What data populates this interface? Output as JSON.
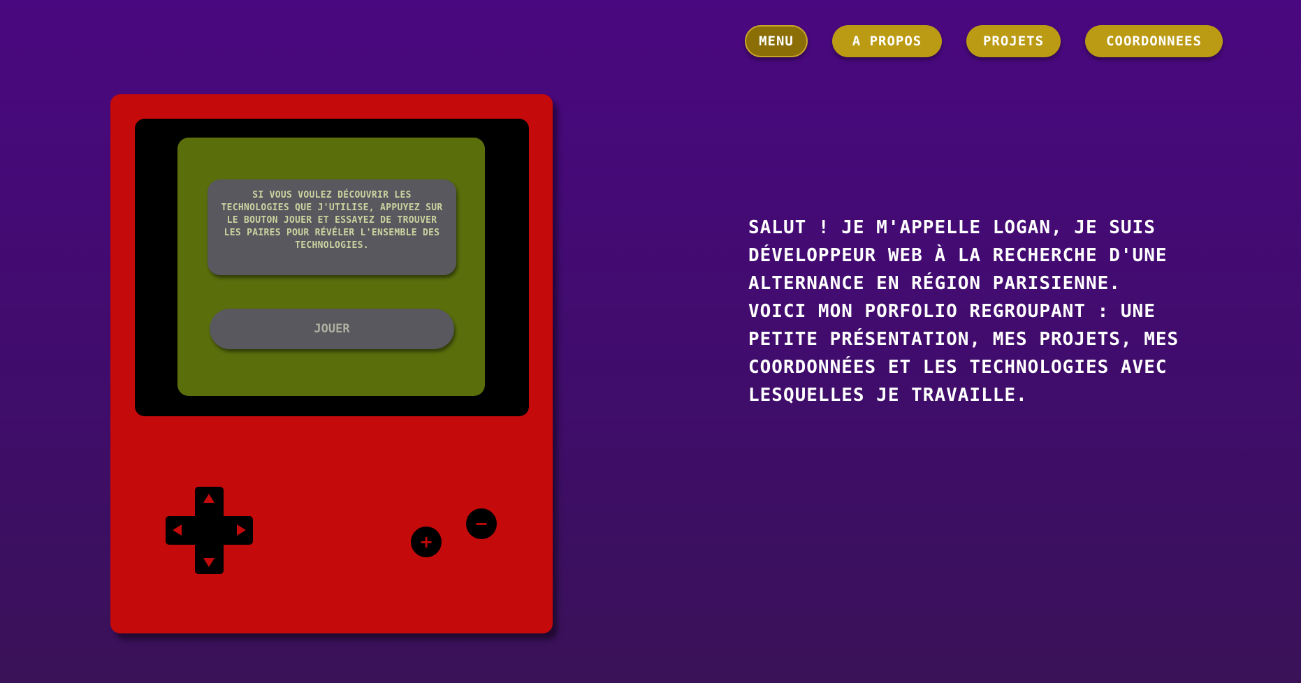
{
  "nav": {
    "items": [
      {
        "label": "MENU",
        "active": true
      },
      {
        "label": "A PROPOS",
        "active": false
      },
      {
        "label": "PROJETS",
        "active": false
      },
      {
        "label": "COORDONNEES",
        "active": false
      }
    ]
  },
  "gameboy": {
    "screen_message": "Si vous voulez découvrir les technologies que j'utilise, appuyez sur le bouton jouer et essayez de trouver les paires pour révéler l'ensemble des technologies.",
    "play_label": "JOUER",
    "plus_label": "+",
    "minus_label": "−",
    "colors": {
      "body": "#c40a0a",
      "bezel": "#000000",
      "screen": "#5a6e0c",
      "panel": "#58585e"
    }
  },
  "intro": {
    "text": "Salut ! Je m'appelle Logan, je suis développeur web à la recherche d'une alternance en région parisienne. Voici mon porfolio regroupant : une petite présentation, mes projets, mes coordonnées et les technologies avec lesquelles je travaille."
  },
  "theme": {
    "background_top": "#4a0880",
    "background_bottom": "#3a1258",
    "nav_button": "#bb9a14",
    "nav_button_active": "#8b6e06"
  }
}
